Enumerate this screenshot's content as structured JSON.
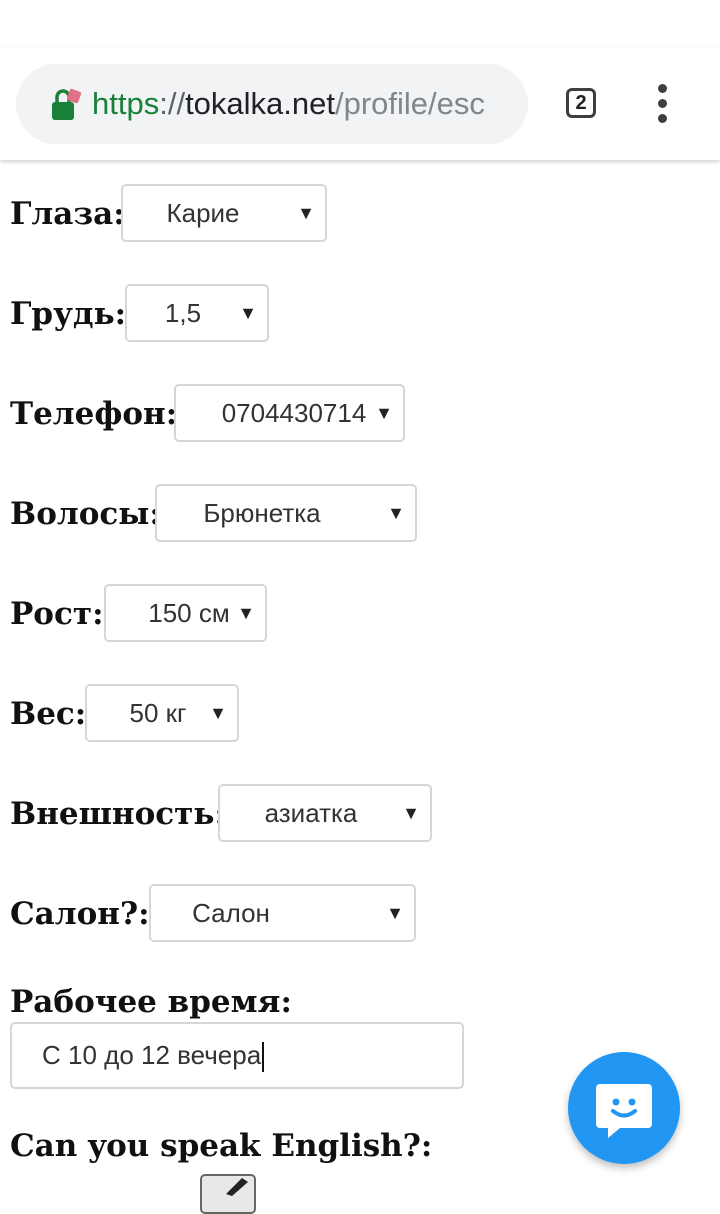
{
  "browser": {
    "url_scheme": "https",
    "url_sep": "://",
    "url_host": "tokalka.net",
    "url_path": "/profile/esc",
    "tab_count": "2"
  },
  "form": {
    "fields": [
      {
        "label": "Глаза:",
        "value": "Карие"
      },
      {
        "label": "Грудь:",
        "value": "1,5"
      },
      {
        "label": "Телефон:",
        "value": "0704430714"
      },
      {
        "label": "Волосы:",
        "value": "Брюнетка"
      },
      {
        "label": "Рост:",
        "value": "150 см"
      },
      {
        "label": "Вес:",
        "value": "50 кг"
      },
      {
        "label": "Внешность:",
        "value": "азиатка"
      },
      {
        "label": "Салон?:",
        "value": "Салон"
      }
    ],
    "work_time_label": "Рабочее время:",
    "work_time_value": "С 10 до 12 вечера",
    "english_label": "Can you speak English?:"
  },
  "colors": {
    "fab": "#2196f3",
    "lock": "#188038"
  },
  "icons": {
    "lock": "lock-icon",
    "chat": "chat-icon",
    "menu": "more-vert-icon",
    "pencil": "pencil-icon"
  }
}
